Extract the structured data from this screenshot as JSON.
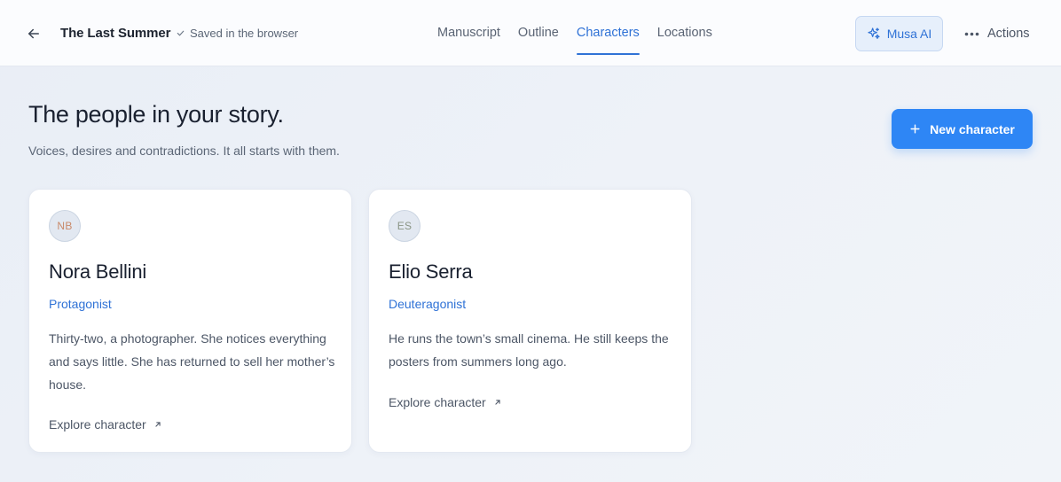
{
  "header": {
    "doc_title": "The Last Summer",
    "save_status": "Saved in the browser",
    "tabs": [
      {
        "label": "Manuscript",
        "active": false
      },
      {
        "label": "Outline",
        "active": false
      },
      {
        "label": "Characters",
        "active": true
      },
      {
        "label": "Locations",
        "active": false
      }
    ],
    "musa_label": "Musa AI",
    "actions_label": "Actions"
  },
  "main": {
    "title": "The people in your story.",
    "subtitle": "Voices, desires and contradictions. It all starts with them.",
    "new_button_label": "New character"
  },
  "characters": [
    {
      "initials": "NB",
      "initials_color": "#c98a6a",
      "name": "Nora Bellini",
      "role": "Protagonist",
      "description": "Thirty-two, a photographer. She notices everything and says little. She has returned to sell her mother’s house.",
      "link_label": "Explore character"
    },
    {
      "initials": "ES",
      "initials_color": "#8a9585",
      "name": "Elio Serra",
      "role": "Deuteragonist",
      "description": "He runs the town’s small cinema. He still keeps the posters from summers long ago.",
      "link_label": "Explore character"
    }
  ],
  "colors": {
    "accent": "#2f72d6",
    "primary_button": "#2e86f5"
  },
  "icons": {
    "back": "arrow-left-icon",
    "saved": "check-icon",
    "musa": "sparkles-icon",
    "actions": "more-horizontal-icon",
    "new": "plus-icon",
    "link": "arrow-up-right-icon"
  }
}
